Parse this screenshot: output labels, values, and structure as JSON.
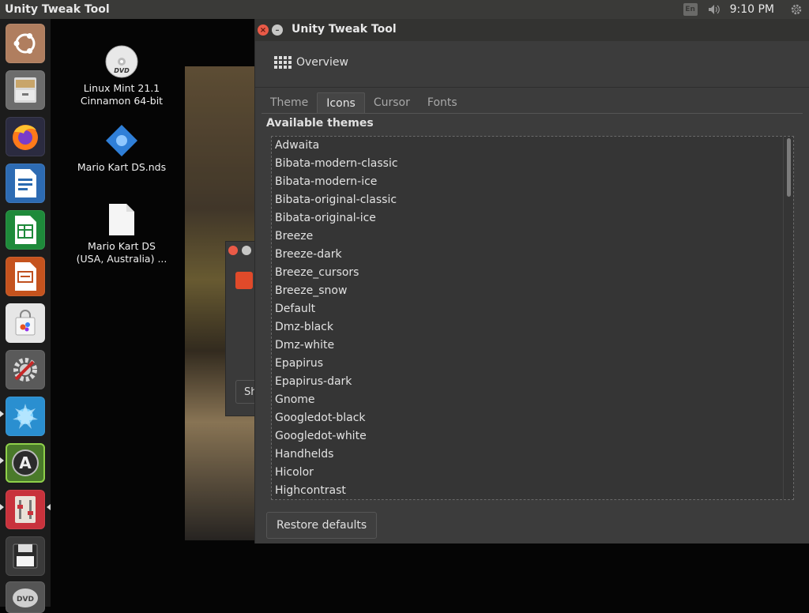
{
  "top_panel": {
    "app_title": "Unity Tweak Tool",
    "clock": "9:10 PM",
    "keyboard_indicator": "En"
  },
  "launcher": {
    "items": [
      {
        "name": "ubuntu-dash",
        "icon": "ubuntu-logo-icon",
        "color": "#b5856a"
      },
      {
        "name": "files",
        "icon": "file-cabinet-icon",
        "color": "#8f8f8f"
      },
      {
        "name": "firefox",
        "icon": "firefox-icon",
        "color": "#e66000"
      },
      {
        "name": "libreoffice-writer",
        "icon": "writer-doc-icon",
        "color": "#2a6ab0"
      },
      {
        "name": "libreoffice-calc",
        "icon": "calc-sheet-icon",
        "color": "#1e8a3a"
      },
      {
        "name": "libreoffice-impress",
        "icon": "impress-slide-icon",
        "color": "#c0501f"
      },
      {
        "name": "software-center",
        "icon": "shopping-bag-icon",
        "color": "#e8e8e8"
      },
      {
        "name": "system-settings",
        "icon": "gear-wrench-icon",
        "color": "#6a6a6a"
      },
      {
        "name": "desktop-app",
        "icon": "blue-splash-icon",
        "color": "#2a8fd0"
      },
      {
        "name": "software-updater",
        "icon": "updater-icon",
        "color": "#4d7a2a"
      },
      {
        "name": "unity-tweak-tool",
        "icon": "tweak-tool-icon",
        "color": "#c8323c"
      },
      {
        "name": "disk-saver",
        "icon": "floppy-icon",
        "color": "#3a3a3a"
      },
      {
        "name": "dvd",
        "icon": "dvd-icon",
        "color": "#9a9a9a"
      }
    ]
  },
  "desktop": {
    "icons": [
      {
        "label_line1": "Linux Mint 21.1",
        "label_line2": "Cinnamon 64-bit",
        "icon": "dvd-icon"
      },
      {
        "label_line1": "Mario Kart DS.nds",
        "label_line2": "",
        "icon": "nds-rom-icon"
      },
      {
        "label_line1": "Mario Kart DS",
        "label_line2": "(USA, Australia) ...",
        "icon": "blank-file-icon"
      }
    ]
  },
  "back_dialog": {
    "button_text": "Sh"
  },
  "window": {
    "title": "Unity Tweak Tool",
    "overview_label": "Overview",
    "tabs": [
      {
        "label": "Theme",
        "active": false
      },
      {
        "label": "Icons",
        "active": true
      },
      {
        "label": "Cursor",
        "active": false
      },
      {
        "label": "Fonts",
        "active": false
      }
    ],
    "section_label": "Available themes",
    "themes": [
      "Adwaita",
      "Bibata-modern-classic",
      "Bibata-modern-ice",
      "Bibata-original-classic",
      "Bibata-original-ice",
      "Breeze",
      "Breeze-dark",
      "Breeze_cursors",
      "Breeze_snow",
      "Default",
      "Dmz-black",
      "Dmz-white",
      "Epapirus",
      "Epapirus-dark",
      "Gnome",
      "Googledot-black",
      "Googledot-white",
      "Handhelds",
      "Hicolor",
      "Highcontrast"
    ],
    "restore_button": "Restore defaults"
  },
  "colors": {
    "panel": "#3a3a38",
    "window_bg": "#3c3c3c",
    "list_bg": "#353535",
    "close_button": "#ea5a47"
  }
}
